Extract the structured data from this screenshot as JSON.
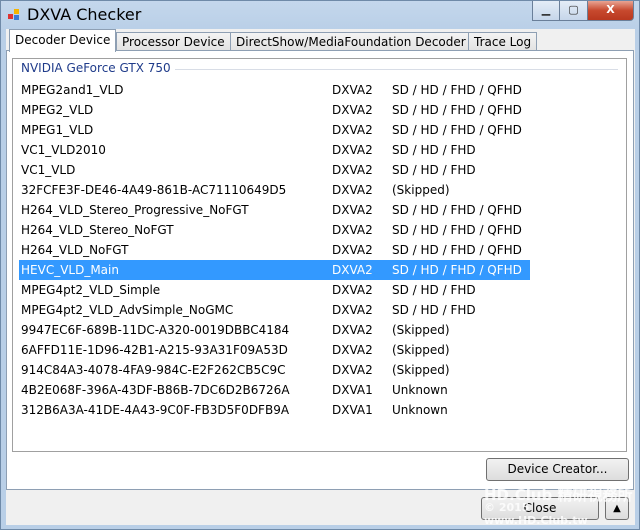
{
  "window": {
    "title": "DXVA Checker"
  },
  "tabs": [
    {
      "label": "Decoder Device"
    },
    {
      "label": "Processor Device"
    },
    {
      "label": "DirectShow/MediaFoundation Decoder"
    },
    {
      "label": "Trace Log"
    }
  ],
  "group": {
    "label": "NVIDIA GeForce GTX 750"
  },
  "rows": [
    {
      "name": "MPEG2and1_VLD",
      "api": "DXVA2",
      "res": "SD / HD / FHD / QFHD"
    },
    {
      "name": "MPEG2_VLD",
      "api": "DXVA2",
      "res": "SD / HD / FHD / QFHD"
    },
    {
      "name": "MPEG1_VLD",
      "api": "DXVA2",
      "res": "SD / HD / FHD / QFHD"
    },
    {
      "name": "VC1_VLD2010",
      "api": "DXVA2",
      "res": "SD / HD / FHD"
    },
    {
      "name": "VC1_VLD",
      "api": "DXVA2",
      "res": "SD / HD / FHD"
    },
    {
      "name": "32FCFE3F-DE46-4A49-861B-AC71110649D5",
      "api": "DXVA2",
      "res": "(Skipped)"
    },
    {
      "name": "H264_VLD_Stereo_Progressive_NoFGT",
      "api": "DXVA2",
      "res": "SD / HD / FHD / QFHD"
    },
    {
      "name": "H264_VLD_Stereo_NoFGT",
      "api": "DXVA2",
      "res": "SD / HD / FHD / QFHD"
    },
    {
      "name": "H264_VLD_NoFGT",
      "api": "DXVA2",
      "res": "SD / HD / FHD / QFHD"
    },
    {
      "name": "HEVC_VLD_Main",
      "api": "DXVA2",
      "res": "SD / HD / FHD / QFHD",
      "selected": true
    },
    {
      "name": "MPEG4pt2_VLD_Simple",
      "api": "DXVA2",
      "res": "SD / HD / FHD"
    },
    {
      "name": "MPEG4pt2_VLD_AdvSimple_NoGMC",
      "api": "DXVA2",
      "res": "SD / HD / FHD"
    },
    {
      "name": "9947EC6F-689B-11DC-A320-0019DBBC4184",
      "api": "DXVA2",
      "res": "(Skipped)"
    },
    {
      "name": "6AFFD11E-1D96-42B1-A215-93A31F09A53D",
      "api": "DXVA2",
      "res": "(Skipped)"
    },
    {
      "name": "914C84A3-4078-4FA9-984C-E2F262CB5C9C",
      "api": "DXVA2",
      "res": "(Skipped)"
    },
    {
      "name": "4B2E068F-396A-43DF-B86B-7DC6D2B6726A",
      "api": "DXVA1",
      "res": "Unknown"
    },
    {
      "name": "312B6A3A-41DE-4A43-9C0F-FB3D5F0DFB9A",
      "api": "DXVA1",
      "res": "Unknown"
    }
  ],
  "buttons": {
    "device_creator": "Device Creator...",
    "close": "Close",
    "up": "▲"
  },
  "watermark": {
    "line1": "HD.Club 精研視務所",
    "line2": "© 2015 www.HD.Club.tw"
  },
  "colors": {
    "selection": "#3399ff",
    "group_label": "#1f3b8a"
  }
}
